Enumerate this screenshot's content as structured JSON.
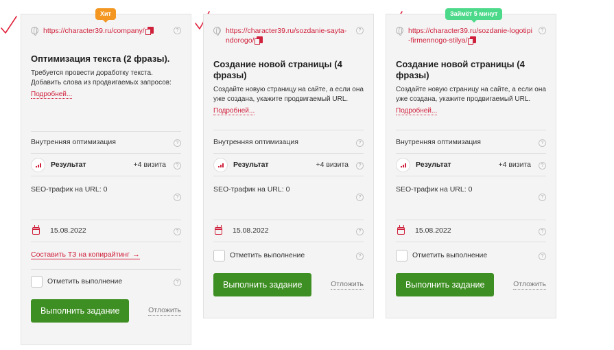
{
  "cards": [
    {
      "badge": "Хит",
      "url": "https://character39.ru/company/",
      "title": "Оптимизация текста (2 фразы).",
      "description": "Требуется провести доработку текста. Добавить слова из продвигаемых запросов:",
      "more": "Подробней...",
      "internal_label": "Внутренняя оптимизация",
      "result_label": "Результат",
      "result_value": "+4 визита",
      "seo_traffic": "SEO-трафик на URL: 0",
      "date": "15.08.2022",
      "tz_link": "Составить ТЗ на копирайтинг",
      "tz_arrow": "→",
      "mark_done": "Отметить выполнение",
      "do_task": "Выполнить задание",
      "postpone": "Отложить"
    },
    {
      "url": "https://character39.ru/sozdanie-sayta-ndorogo/",
      "title": "Создание новой страницы (4 фразы)",
      "description": "Создайте новую страницу на сайте, а если она уже создана, укажите продвигаемый URL.",
      "more": "Подробней...",
      "internal_label": "Внутренняя оптимизация",
      "result_label": "Результат",
      "result_value": "+4 визита",
      "seo_traffic": "SEO-трафик на URL: 0",
      "date": "15.08.2022",
      "mark_done": "Отметить выполнение",
      "do_task": "Выполнить задание",
      "postpone": "Отложить"
    },
    {
      "badge": "Займёт 5 минут",
      "url": "https://character39.ru/sozdanie-logotipi-firmennogo-stilya/",
      "title": "Создание новой страницы (4 фразы)",
      "description": "Создайте новую страницу на сайте, а если она уже создана, укажите продвигаемый URL.",
      "more": "Подробней...",
      "internal_label": "Внутренняя оптимизация",
      "result_label": "Результат",
      "result_value": "+4 визита",
      "seo_traffic": "SEO-трафик на URL: 0",
      "date": "15.08.2022",
      "mark_done": "Отметить выполнение",
      "do_task": "Выполнить задание",
      "postpone": "Отложить"
    }
  ],
  "help_glyph": "?",
  "colors": {
    "accent": "#d0213c",
    "button": "#3e8f23",
    "badge_hit": "#f39722",
    "badge_time": "#4cd98a",
    "card_bg": "#f4f4f4"
  },
  "icons": [
    "checkmark-annotation-icon",
    "globe-icon",
    "copy-icon",
    "help-icon",
    "bar-chart-icon",
    "calendar-icon",
    "arrow-right-icon"
  ]
}
